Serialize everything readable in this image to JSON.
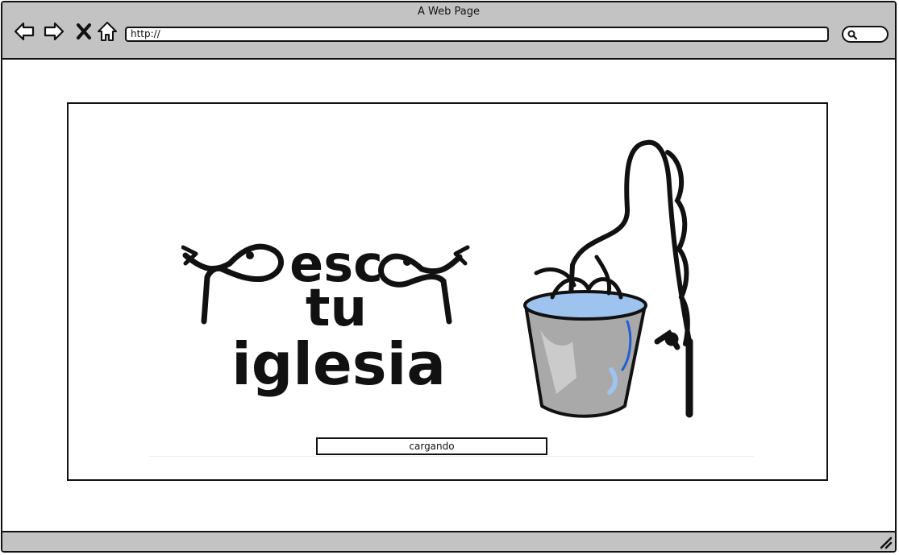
{
  "window": {
    "title": "A Web Page"
  },
  "address_bar": {
    "url": "http://"
  },
  "icons": {
    "back": "back-arrow-icon",
    "forward": "forward-arrow-icon",
    "stop": "close-icon",
    "home": "home-icon",
    "search": "search-icon",
    "resize": "resize-grip-icon"
  },
  "logo": {
    "line1": "pesca",
    "line2": "tu",
    "line3": "iglesia"
  },
  "progress": {
    "label": "cargando"
  },
  "colors": {
    "chrome": "#c3c3c3",
    "water": "#9ec3ef",
    "water_accent": "#1e5fd6",
    "bucket": "#a9a9a9"
  }
}
